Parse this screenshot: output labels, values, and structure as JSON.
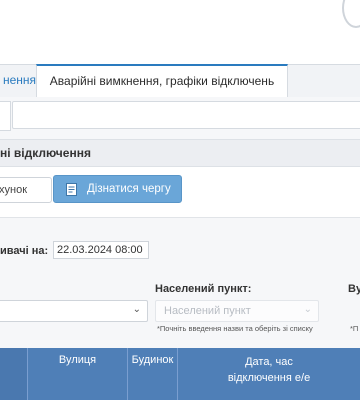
{
  "header": {
    "logo": "logo-fragment"
  },
  "tabs": [
    {
      "label": "нення",
      "active": false
    },
    {
      "label": "Аварійні вимкнення, графіки відключень",
      "active": true
    }
  ],
  "section": {
    "title": "ні відключення"
  },
  "search": {
    "input_value": "хунок",
    "button_label": "Дізнатися чергу",
    "button_icon": "document-icon"
  },
  "date_filter": {
    "label": "ивачі на:",
    "value": "22.03.2024 08:00"
  },
  "filters": {
    "settlement_label": "Населений пункт:",
    "settlement_placeholder": "Населений пункт",
    "settlement_hint": "*Почніть введення назви та оберіть зі списку",
    "street_label": "Ву",
    "street_hint": "*П"
  },
  "table": {
    "columns": [
      "Вулиця",
      "Будинок",
      "Дата, час",
      "відключення е/е"
    ]
  },
  "colors": {
    "accent": "#2a7bbf",
    "button": "#6aa6d8",
    "table_header": "#4f7fb7"
  }
}
